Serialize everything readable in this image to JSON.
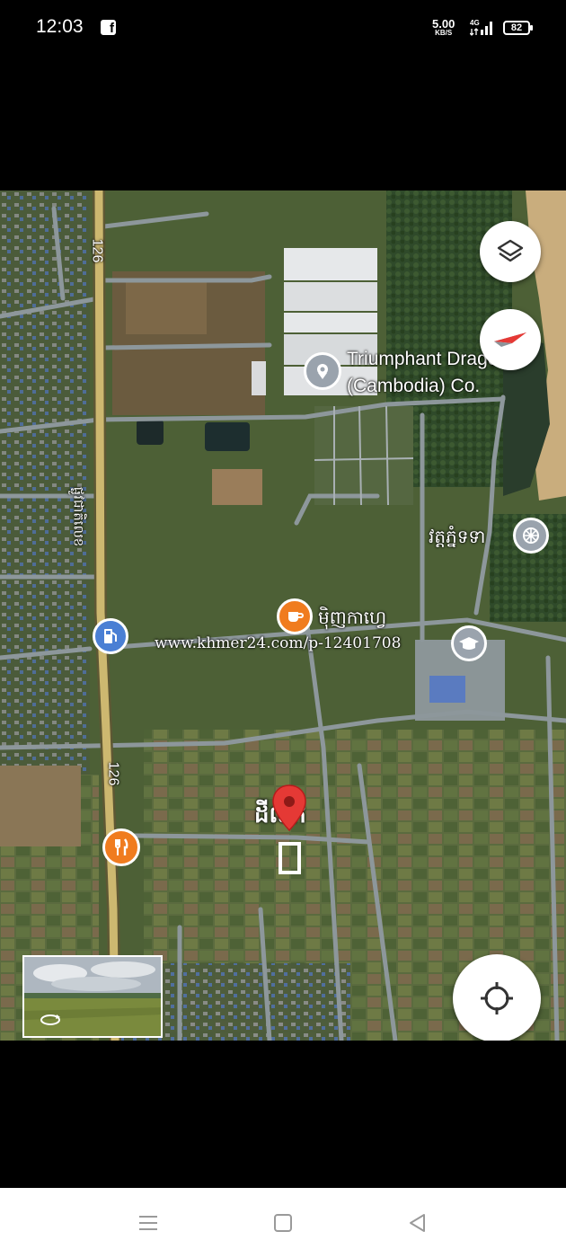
{
  "status_bar": {
    "time": "12:03",
    "notification_icon": "facebook-icon",
    "net_speed_value": "5.00",
    "net_speed_unit": "KB/S",
    "network_type": "4G",
    "battery": "82"
  },
  "map": {
    "labels": {
      "road_126_top": "126",
      "road_126_bottom": "126",
      "road_name_vertical": "ផ្លូវជាតិលេខ",
      "factory_name_line1": "Triumphant Dragon",
      "factory_name_line2": "(Cambodia) Co.",
      "pagoda": "វត្តភ្នំទទា",
      "cafe": "ម៉ិញកាហ្វេ",
      "land_for_sale": "ដីលក់"
    },
    "watermark": "www.khmer24.com/p-12401708",
    "icons": {
      "layers": "layers-icon",
      "compass": "compass-icon",
      "my_location": "crosshair-icon",
      "street_view_rotate": "rotate-360-icon",
      "factory_pin": "map-pin-icon",
      "pagoda_poi": "dharma-wheel-icon",
      "cafe_poi": "coffee-cup-icon",
      "school_poi": "graduation-cap-icon",
      "gas_poi": "fuel-pump-icon",
      "restaurant_poi": "fork-knife-icon",
      "selected_pin": "red-pin-icon"
    },
    "colors": {
      "poi_orange": "#f07c1f",
      "poi_blue": "#4a7fd4",
      "poi_gray": "#9aa3ad",
      "selected_pin": "#e53935",
      "highway": "#c9b36a",
      "road": "#8d979b"
    }
  },
  "nav_bar": {
    "icons": [
      "menu-icon",
      "home-square-icon",
      "back-triangle-icon"
    ]
  }
}
